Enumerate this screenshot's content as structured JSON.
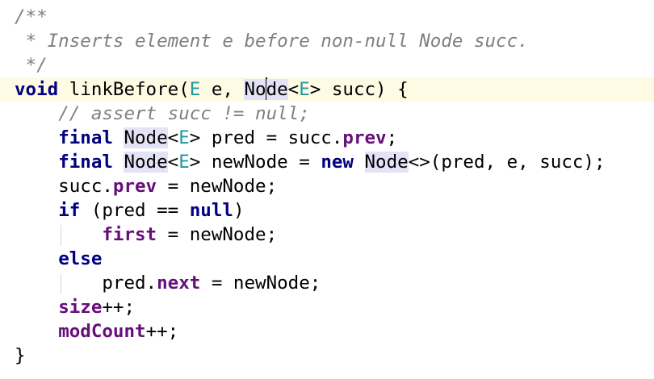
{
  "editor": {
    "colors": {
      "background": "#ffffff",
      "current_line": "#fffae3",
      "keyword": "#000080",
      "field": "#660e7a",
      "type_param": "#20999d",
      "comment": "#808080",
      "usage_highlight": "#e3e2f7"
    },
    "lines": [
      {
        "text": "/**",
        "tokens": [
          {
            "text": "/**",
            "style": "cmt"
          }
        ]
      },
      {
        "text": " * Inserts element e before non-null Node succ.",
        "tokens": [
          {
            "text": " * Inserts element e before non-null Node succ.",
            "style": "cmt"
          }
        ]
      },
      {
        "text": " */",
        "tokens": [
          {
            "text": " */",
            "style": "cmt"
          }
        ]
      },
      {
        "text": "void linkBefore(E e, Node<E> succ) {",
        "current": true,
        "tokens": [
          {
            "text": "void",
            "style": "kw"
          },
          {
            "text": " linkBefore(",
            "style": "plain"
          },
          {
            "text": "E",
            "style": "tp"
          },
          {
            "text": " e, ",
            "style": "plain"
          },
          {
            "text": "No",
            "style": "hl"
          },
          {
            "caret": true
          },
          {
            "text": "de",
            "style": "hl"
          },
          {
            "text": "<",
            "style": "plain"
          },
          {
            "text": "E",
            "style": "tp"
          },
          {
            "text": "> succ) {",
            "style": "plain"
          }
        ]
      },
      {
        "text": "    // assert succ != null;",
        "tokens": [
          {
            "text": "    ",
            "style": "plain"
          },
          {
            "text": "// assert succ != null;",
            "style": "cmt"
          }
        ]
      },
      {
        "text": "    final Node<E> pred = succ.prev;",
        "tokens": [
          {
            "text": "    ",
            "style": "plain"
          },
          {
            "text": "final",
            "style": "kw"
          },
          {
            "text": " ",
            "style": "plain"
          },
          {
            "text": "Node",
            "style": "hl"
          },
          {
            "text": "<",
            "style": "plain"
          },
          {
            "text": "E",
            "style": "tp"
          },
          {
            "text": "> pred = succ.",
            "style": "plain"
          },
          {
            "text": "prev",
            "style": "field"
          },
          {
            "text": ";",
            "style": "plain"
          }
        ]
      },
      {
        "text": "    final Node<E> newNode = new Node<>(pred, e, succ);",
        "tokens": [
          {
            "text": "    ",
            "style": "plain"
          },
          {
            "text": "final",
            "style": "kw"
          },
          {
            "text": " ",
            "style": "plain"
          },
          {
            "text": "Node",
            "style": "hl"
          },
          {
            "text": "<",
            "style": "plain"
          },
          {
            "text": "E",
            "style": "tp"
          },
          {
            "text": "> newNode = ",
            "style": "plain"
          },
          {
            "text": "new",
            "style": "kw"
          },
          {
            "text": " ",
            "style": "plain"
          },
          {
            "text": "Node",
            "style": "hl"
          },
          {
            "text": "<>(pred, e, succ);",
            "style": "plain"
          }
        ]
      },
      {
        "text": "    succ.prev = newNode;",
        "tokens": [
          {
            "text": "    succ.",
            "style": "plain"
          },
          {
            "text": "prev",
            "style": "field"
          },
          {
            "text": " = newNode;",
            "style": "plain"
          }
        ]
      },
      {
        "text": "    if (pred == null)",
        "tokens": [
          {
            "text": "    ",
            "style": "plain"
          },
          {
            "text": "if",
            "style": "kw"
          },
          {
            "text": " (pred == ",
            "style": "plain"
          },
          {
            "text": "null",
            "style": "kw"
          },
          {
            "text": ")",
            "style": "plain"
          }
        ]
      },
      {
        "text": "        first = newNode;",
        "tokens": [
          {
            "text": "        ",
            "style": "plain"
          },
          {
            "text": "first",
            "style": "field"
          },
          {
            "text": " = newNode;",
            "style": "plain"
          }
        ]
      },
      {
        "text": "    else",
        "tokens": [
          {
            "text": "    ",
            "style": "plain"
          },
          {
            "text": "else",
            "style": "kw"
          }
        ]
      },
      {
        "text": "        pred.next = newNode;",
        "tokens": [
          {
            "text": "        pred.",
            "style": "plain"
          },
          {
            "text": "next",
            "style": "field"
          },
          {
            "text": " = newNode;",
            "style": "plain"
          }
        ]
      },
      {
        "text": "    size++;",
        "tokens": [
          {
            "text": "    ",
            "style": "plain"
          },
          {
            "text": "size",
            "style": "field"
          },
          {
            "text": "++;",
            "style": "plain"
          }
        ]
      },
      {
        "text": "    modCount++;",
        "tokens": [
          {
            "text": "    ",
            "style": "plain"
          },
          {
            "text": "modCount",
            "style": "field"
          },
          {
            "text": "++;",
            "style": "plain"
          }
        ]
      },
      {
        "text": "}",
        "tokens": [
          {
            "text": "}",
            "style": "plain"
          }
        ]
      }
    ]
  }
}
